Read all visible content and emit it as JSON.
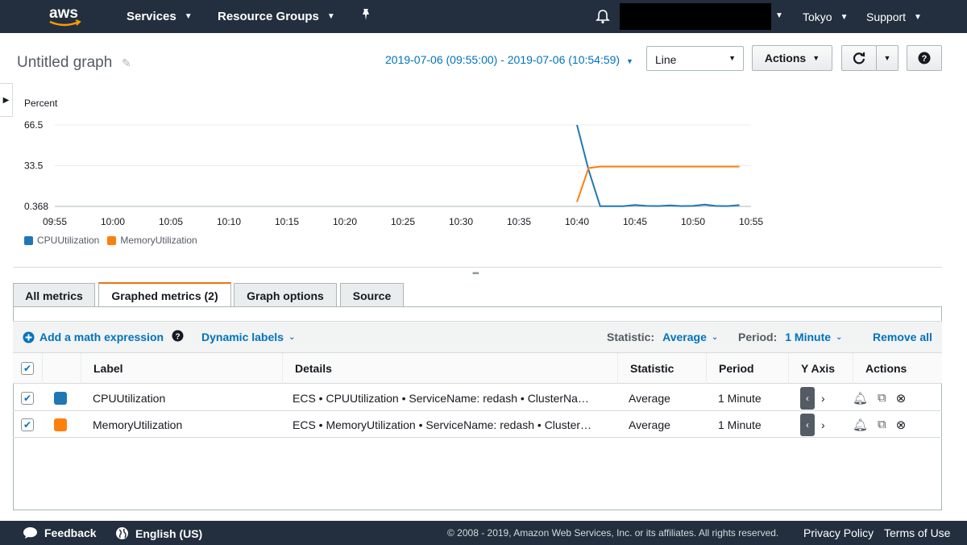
{
  "nav": {
    "logo_text": "aws",
    "services": "Services",
    "resource_groups": "Resource Groups",
    "region": "Tokyo",
    "support": "Support"
  },
  "header": {
    "title": "Untitled graph",
    "time_range": "2019-07-06 (09:55:00) - 2019-07-06 (10:54:59)",
    "view_type": "Line",
    "actions": "Actions"
  },
  "colors": {
    "cpu": "#1f77b4",
    "memory": "#ff7f0e",
    "brand_dark": "#232f3e",
    "link": "#0073bb"
  },
  "chart_data": {
    "type": "line",
    "ylabel": "Percent",
    "y_ticks": [
      "0.368",
      "33.5",
      "66.5"
    ],
    "ylim": [
      0.368,
      66.5
    ],
    "x_ticks": [
      "09:55",
      "10:00",
      "10:05",
      "10:10",
      "10:15",
      "10:20",
      "10:25",
      "10:30",
      "10:35",
      "10:40",
      "10:45",
      "10:50",
      "10:55"
    ],
    "x": [
      "10:40",
      "10:41",
      "10:42",
      "10:43",
      "10:44",
      "10:45",
      "10:46",
      "10:47",
      "10:48",
      "10:49",
      "10:50",
      "10:51",
      "10:52",
      "10:53",
      "10:54"
    ],
    "series": [
      {
        "name": "CPUUtilization",
        "values": [
          66.5,
          30,
          0.5,
          0.5,
          0.5,
          1.5,
          0.8,
          0.6,
          1.2,
          0.6,
          0.8,
          1.8,
          0.7,
          0.6,
          1.4
        ]
      },
      {
        "name": "MemoryUtilization",
        "values": [
          4,
          31.5,
          32.7,
          32.7,
          32.7,
          32.7,
          32.7,
          32.7,
          32.7,
          32.7,
          32.7,
          32.7,
          32.7,
          32.7,
          32.7
        ]
      }
    ],
    "legend_position": "bottom-left",
    "grid": true
  },
  "tabs": [
    {
      "label": "All metrics"
    },
    {
      "label": "Graphed metrics (2)"
    },
    {
      "label": "Graph options"
    },
    {
      "label": "Source"
    }
  ],
  "toolbar": {
    "add_math": "Add a math expression",
    "dynamic_labels": "Dynamic labels",
    "statistic_label": "Statistic:",
    "statistic_value": "Average",
    "period_label": "Period:",
    "period_value": "1 Minute",
    "remove_all": "Remove all"
  },
  "table": {
    "headers": {
      "label": "Label",
      "details": "Details",
      "statistic": "Statistic",
      "period": "Period",
      "y_axis": "Y Axis",
      "actions": "Actions"
    },
    "rows": [
      {
        "label": "CPUUtilization",
        "details": "ECS • CPUUtilization • ServiceName: redash • ClusterNa…",
        "statistic": "Average",
        "period": "1 Minute"
      },
      {
        "label": "MemoryUtilization",
        "details": "ECS • MemoryUtilization • ServiceName: redash • Cluster…",
        "statistic": "Average",
        "period": "1 Minute"
      }
    ]
  },
  "footer": {
    "feedback": "Feedback",
    "language": "English (US)",
    "copyright": "© 2008 - 2019, Amazon Web Services, Inc. or its affiliates. All rights reserved.",
    "privacy": "Privacy Policy",
    "terms": "Terms of Use"
  }
}
